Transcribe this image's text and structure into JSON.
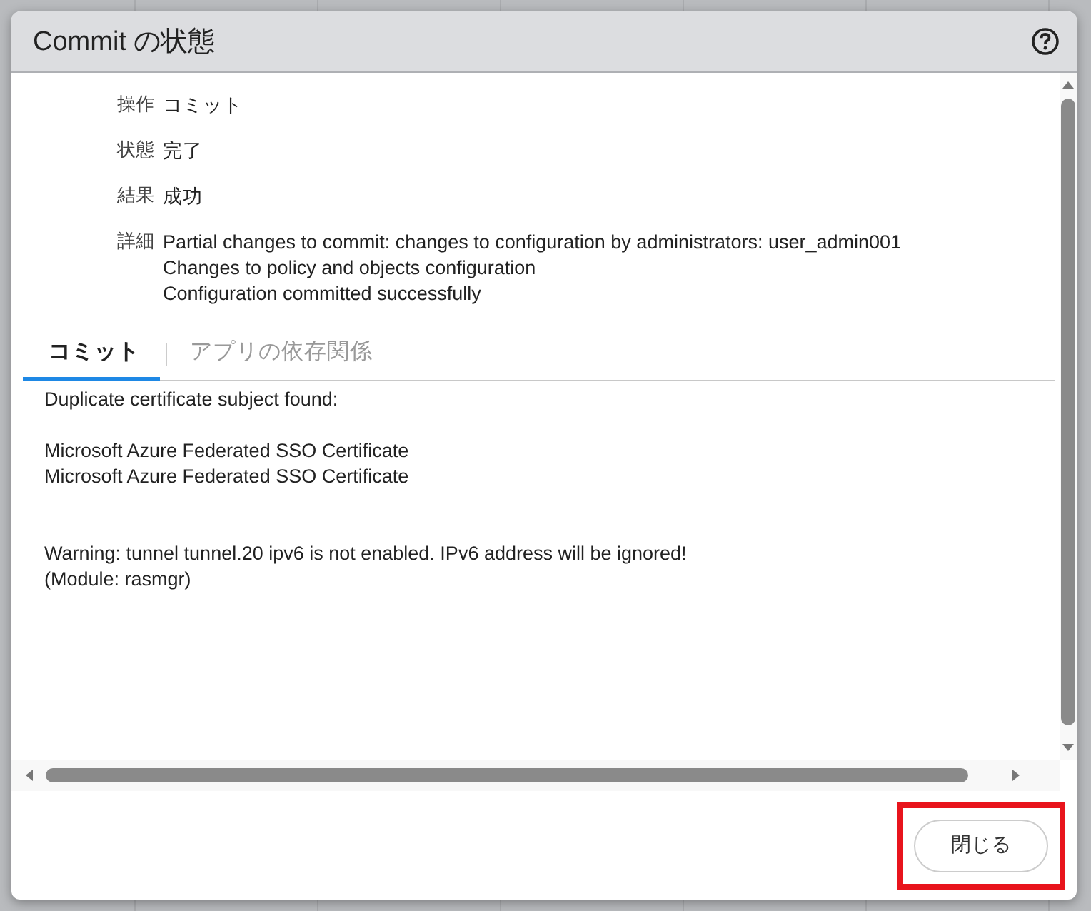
{
  "window": {
    "title": "Commit の状態"
  },
  "fields": [
    {
      "label": "操作",
      "lines": [
        "コミット"
      ]
    },
    {
      "label": "状態",
      "lines": [
        "完了"
      ]
    },
    {
      "label": "結果",
      "lines": [
        "成功"
      ]
    },
    {
      "label": "詳細",
      "lines": [
        "Partial changes to commit: changes to configuration by administrators: user_admin001",
        "Changes to policy and objects configuration",
        "Configuration committed successfully"
      ]
    }
  ],
  "tabs": [
    {
      "label": "コミット",
      "selected": true
    },
    {
      "label": "アプリの依存関係",
      "selected": false
    }
  ],
  "log_blocks": [
    {
      "kind": "message",
      "lines": [
        "Duplicate certificate subject found:"
      ]
    },
    {
      "kind": "detail",
      "lines": [
        "Microsoft Azure Federated SSO Certificate",
        "Microsoft Azure Federated SSO Certificate"
      ]
    },
    {
      "kind": "warning",
      "lines": [
        "Warning: tunnel tunnel.20 ipv6 is not enabled. IPv6 address will be ignored!",
        "(Module: rasmgr)"
      ]
    }
  ],
  "close_button": {
    "label": "閉じる",
    "highlighted": true
  }
}
